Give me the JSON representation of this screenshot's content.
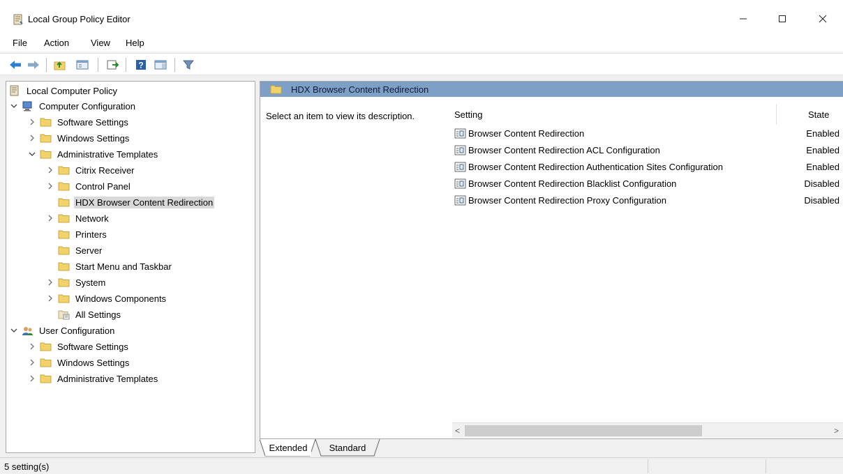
{
  "window": {
    "title": "Local Group Policy Editor",
    "controls": {
      "minimize": "—",
      "maximize": "☐",
      "close": "✕"
    }
  },
  "menu": [
    "File",
    "Action",
    "View",
    "Help"
  ],
  "toolbar": {
    "buttons": [
      "back-icon",
      "forward-icon",
      "up-folder-icon",
      "show-hide-tree-icon",
      "export-list-icon",
      "help-icon",
      "show-hide-action-pane-icon",
      "filter-icon"
    ]
  },
  "tree": {
    "root": "Local Computer Policy",
    "items": [
      {
        "label": "Computer Configuration"
      },
      {
        "label": "Software Settings"
      },
      {
        "label": "Windows Settings"
      },
      {
        "label": "Administrative Templates"
      },
      {
        "label": "Citrix Receiver"
      },
      {
        "label": "Control Panel"
      },
      {
        "label": "HDX Browser Content Redirection",
        "selected": true
      },
      {
        "label": "Network"
      },
      {
        "label": "Printers"
      },
      {
        "label": "Server"
      },
      {
        "label": "Start Menu and Taskbar"
      },
      {
        "label": "System"
      },
      {
        "label": "Windows Components"
      },
      {
        "label": "All Settings"
      },
      {
        "label": "User Configuration"
      },
      {
        "label": "Software Settings"
      },
      {
        "label": "Windows Settings"
      },
      {
        "label": "Administrative Templates"
      }
    ]
  },
  "details": {
    "header": "HDX Browser Content Redirection",
    "description": "Select an item to view its description.",
    "columns": {
      "setting": "Setting",
      "state": "State"
    },
    "settings": [
      {
        "name": "Browser Content Redirection",
        "state": "Enabled"
      },
      {
        "name": "Browser Content Redirection ACL Configuration",
        "state": "Enabled"
      },
      {
        "name": "Browser Content Redirection Authentication Sites Configuration",
        "state": "Enabled"
      },
      {
        "name": "Browser Content Redirection Blacklist Configuration",
        "state": "Disabled"
      },
      {
        "name": "Browser Content Redirection Proxy Configuration",
        "state": "Disabled"
      }
    ]
  },
  "scrollbar": {
    "left_arrow": "<",
    "right_arrow": ">"
  },
  "tabs": [
    "Extended",
    "Standard"
  ],
  "status": {
    "text": "5 setting(s)"
  },
  "colors": {
    "detail_header": "#7fa0c6",
    "folder": "#f2d36b",
    "selection": "#d9d9d9"
  }
}
